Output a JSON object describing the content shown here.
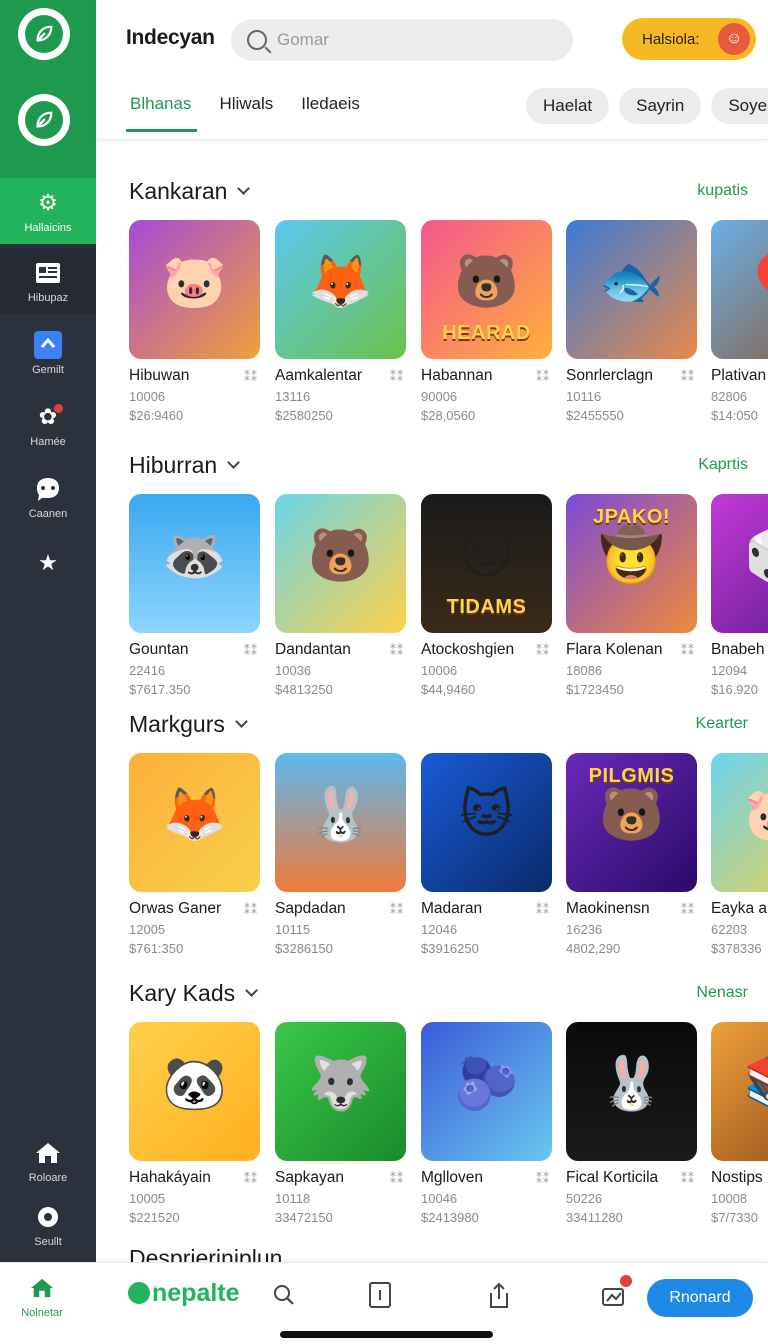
{
  "header": {
    "title": "Indecyan",
    "search_placeholder": "Gomar",
    "user_label": "Halsiola:",
    "user_avatar_icon": "avatar-face-icon"
  },
  "sidebar": {
    "logo_icon": "leaf-logo-icon",
    "items": [
      {
        "label": "Hallaicins",
        "icon": "gear-icon"
      },
      {
        "label": "Hibupaz",
        "icon": "news-icon"
      },
      {
        "label": "Gemilt",
        "icon": "upload-icon"
      },
      {
        "label": "Hamée",
        "icon": "puzzle-icon"
      },
      {
        "label": "Caanen",
        "icon": "chat-icon"
      },
      {
        "label": "",
        "icon": "star-icon"
      },
      {
        "label": "Roloare",
        "icon": "home-icon"
      },
      {
        "label": "Seullt",
        "icon": "settings-icon"
      }
    ]
  },
  "tabs": [
    "Blhanas",
    "Hliwals",
    "Iledaeis"
  ],
  "chips": [
    "Haelat",
    "Sayrin",
    "Soyem"
  ],
  "sections": [
    {
      "title": "Kankaran",
      "more": "kupatis",
      "cards": [
        {
          "name": "Hibuwan",
          "a": "10006",
          "b": "$26:9460",
          "glyph": "🐷",
          "bg": "linear-gradient(135deg,#a64ad8,#f0a03a)"
        },
        {
          "name": "Aamkalentar",
          "a": "13116",
          "b": "$2580250",
          "glyph": "🦊",
          "bg": "linear-gradient(135deg,#5cc8f0,#6cc24a)"
        },
        {
          "name": "Habannan",
          "a": "90006",
          "b": "$28,0560",
          "glyph": "🐻",
          "bg": "linear-gradient(135deg,#f5568f,#ffb03a)",
          "word": "HEARAD"
        },
        {
          "name": "Sonrlerclagn",
          "a": "10116",
          "b": "$2455550",
          "glyph": "🐟",
          "bg": "linear-gradient(135deg,#3a7ad8,#e88a4a)"
        },
        {
          "name": "Plativan",
          "a": "82806",
          "b": "$14:050",
          "glyph": "🎈",
          "bg": "linear-gradient(135deg,#6ab0e8,#8b5a3a)"
        }
      ]
    },
    {
      "title": "Hiburran",
      "more": "Kaprtis",
      "cards": [
        {
          "name": "Gountan",
          "a": "22416",
          "b": "$7617.350",
          "glyph": "🦝",
          "bg": "linear-gradient(180deg,#3aa8f0,#8fd4ff)"
        },
        {
          "name": "Dandantan",
          "a": "10036",
          "b": "$4813250",
          "glyph": "🐻",
          "bg": "linear-gradient(135deg,#6ad4e8,#ffd24a)"
        },
        {
          "name": "Atockoshgien",
          "a": "10006",
          "b": "$44,9460",
          "glyph": "🐱",
          "bg": "linear-gradient(180deg,#1a1a1a,#3a2a1a)",
          "word": "TIDAMS"
        },
        {
          "name": "Flara Kolenan",
          "a": "18086",
          "b": "$1723450",
          "glyph": "🤠",
          "bg": "linear-gradient(135deg,#7a4ad8,#f08a3a)",
          "word": "JPAKO!",
          "wordTop": true
        },
        {
          "name": "Bnabeh",
          "a": "12094",
          "b": "$16.920",
          "glyph": "🎲",
          "bg": "linear-gradient(135deg,#c43ad8,#5a1a8a)"
        }
      ]
    },
    {
      "title": "Markgurs",
      "more": "Kearter",
      "cards": [
        {
          "name": "Orwas Ganer",
          "a": "12005",
          "b": "$761:350",
          "glyph": "🦊",
          "bg": "linear-gradient(135deg,#ffb03a,#f5d04a)"
        },
        {
          "name": "Sapdadan",
          "a": "10115",
          "b": "$3286150",
          "glyph": "🐰",
          "bg": "linear-gradient(180deg,#5cb8f0,#f07a3a)"
        },
        {
          "name": "Madaran",
          "a": "12046",
          "b": "$3916250",
          "glyph": "🐱",
          "bg": "linear-gradient(135deg,#1a5ad8,#0a2a6a)"
        },
        {
          "name": "Maokinensn",
          "a": "16236",
          "b": "4802,290",
          "glyph": "🐻",
          "bg": "linear-gradient(135deg,#6a2ab8,#2a0a6a)",
          "word": "PILGMIS",
          "wordTop": true
        },
        {
          "name": "Eayka a",
          "a": "62203",
          "b": "$378336",
          "glyph": "🐷",
          "bg": "linear-gradient(135deg,#6ad4f0,#f0d04a)"
        }
      ]
    },
    {
      "title": "Kary Kads",
      "more": "Nenasr",
      "cards": [
        {
          "name": "Hahakáyain",
          "a": "10005",
          "b": "$221520",
          "glyph": "🐼",
          "bg": "linear-gradient(135deg,#ffd04a,#ffb020)"
        },
        {
          "name": "Sapkayan",
          "a": "10118",
          "b": "33472150",
          "glyph": "🐺",
          "bg": "linear-gradient(135deg,#3ac84a,#1a8a2a)"
        },
        {
          "name": "Mglloven",
          "a": "10046",
          "b": "$2413980",
          "glyph": "🫐",
          "bg": "linear-gradient(135deg,#3a5ad8,#6ac8f0)"
        },
        {
          "name": "Fical Korticila",
          "a": "50226",
          "b": "33411280",
          "glyph": "🐰",
          "bg": "linear-gradient(180deg,#0a0a0a,#1a1a1a)"
        },
        {
          "name": "Nostips",
          "a": "10008",
          "b": "$7/7330",
          "glyph": "📚",
          "bg": "linear-gradient(135deg,#f0a03a,#8b4a1a)"
        }
      ]
    }
  ],
  "next_section_title": "Desprieriniplun",
  "bottombar": {
    "home_label": "Nolnetar",
    "brand": "nepalte",
    "cta_label": "Rnonard",
    "icons": [
      "home-icon",
      "search-icon",
      "info-icon",
      "share-icon",
      "notification-icon"
    ]
  }
}
